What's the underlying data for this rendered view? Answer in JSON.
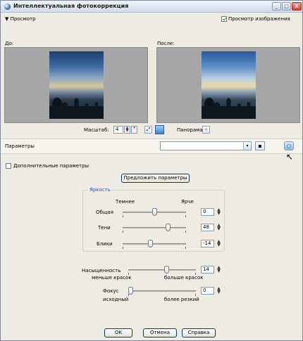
{
  "window": {
    "title": "Интеллектуальная фотокоррекция",
    "icon": "app-globe-icon",
    "buttons": {
      "minimize": "_",
      "maximize": "□",
      "close": "X"
    }
  },
  "preview": {
    "section_label": "Просмотр",
    "show_preview_label": "Просмотр изображения",
    "show_preview_checked": true,
    "before_label": "До:",
    "after_label": "После:"
  },
  "zoom": {
    "label": "Масштаб:",
    "value": "4",
    "pan_label": "Панорама:",
    "pan_icon": "+"
  },
  "presets": {
    "label": "Параметры",
    "value": "",
    "dropdown_icon": "▾",
    "save_icon": "▪",
    "reset_icon": "○"
  },
  "advanced": {
    "label": "Дополнительные параметры",
    "checked": false
  },
  "suggest_button": "Предложить параметры",
  "brightness_group": {
    "title": "Яркость",
    "left_caption": "Темнее",
    "right_caption": "Ярче",
    "sliders": [
      {
        "label": "Общая",
        "value": "0",
        "level_fraction": 0.5
      },
      {
        "label": "Тени",
        "value": "48",
        "level_fraction": 0.74
      },
      {
        "label": "Блики",
        "value": "-14",
        "level_fraction": 0.43
      }
    ]
  },
  "saturation": {
    "label": "Насыщенность",
    "value": "14",
    "left_caption": "меньше красок",
    "right_caption": "больше красок",
    "level_fraction": 0.57
  },
  "focus": {
    "label": "Фокус",
    "value": "0",
    "left_caption": "исходный",
    "right_caption": "более резкий",
    "level_fraction": 0.0
  },
  "footer": {
    "ok": "OK",
    "cancel": "Отмена",
    "help": "Справка"
  },
  "colors": {
    "accent": "#1a56c8",
    "window_bg": "#edebe2",
    "preview_bg": "#a6a6a6"
  }
}
